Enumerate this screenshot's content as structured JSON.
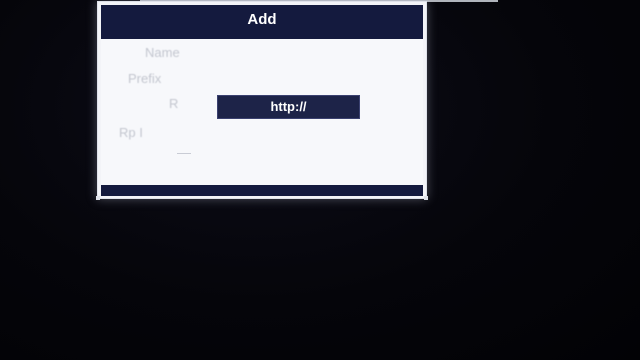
{
  "dialog": {
    "title": "Add",
    "fields": [
      {
        "label": "Name"
      },
      {
        "label": "Prefix"
      },
      {
        "label": "R"
      },
      {
        "label": "Rp I"
      }
    ],
    "url_input": {
      "value": "http://"
    }
  },
  "colors": {
    "title_bar": "#141a3e",
    "dialog_body": "#f7f8fb",
    "input_bg": "#1d2348",
    "background": "#05050a"
  }
}
